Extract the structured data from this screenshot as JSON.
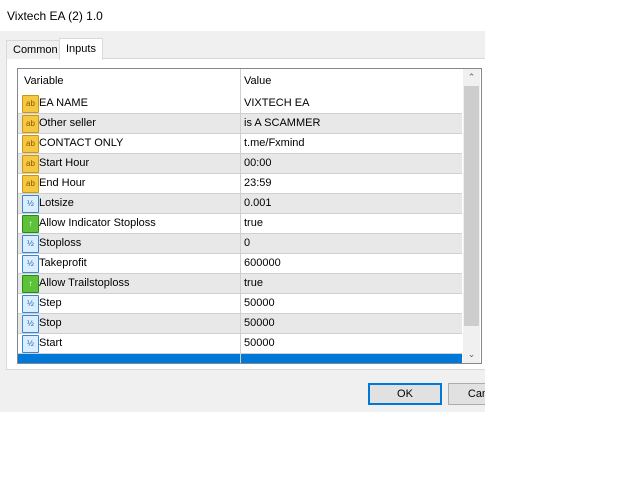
{
  "title": "Vixtech EA (2) 1.0",
  "tabs": {
    "common": "Common",
    "inputs": "Inputs"
  },
  "columns": {
    "variable": "Variable",
    "value": "Value"
  },
  "rows": [
    {
      "name": "EA NAME",
      "value": "VIXTECH EA",
      "type": "ab"
    },
    {
      "name": "Other seller",
      "value": "is A SCAMMER",
      "type": "ab"
    },
    {
      "name": "CONTACT ONLY",
      "value": "t.me/Fxmind",
      "type": "ab"
    },
    {
      "name": "Start Hour",
      "value": "00:00",
      "type": "ab"
    },
    {
      "name": "End Hour",
      "value": "23:59",
      "type": "ab"
    },
    {
      "name": "Lotsize",
      "value": "0.001",
      "type": "num"
    },
    {
      "name": "Allow Indicator Stoploss",
      "value": "true",
      "type": "bool"
    },
    {
      "name": "Stoploss",
      "value": "0",
      "type": "num"
    },
    {
      "name": "Takeprofit",
      "value": "600000",
      "type": "num"
    },
    {
      "name": "Allow Trailstoploss",
      "value": "true",
      "type": "bool"
    },
    {
      "name": "Step",
      "value": "50000",
      "type": "num"
    },
    {
      "name": "Stop",
      "value": "50000",
      "type": "num"
    },
    {
      "name": "Start",
      "value": "50000",
      "type": "num"
    }
  ],
  "icons": {
    "ab": "ab",
    "num": "½",
    "bool": "↑"
  },
  "buttons": {
    "ok": "OK",
    "cancel": "Cancel"
  }
}
